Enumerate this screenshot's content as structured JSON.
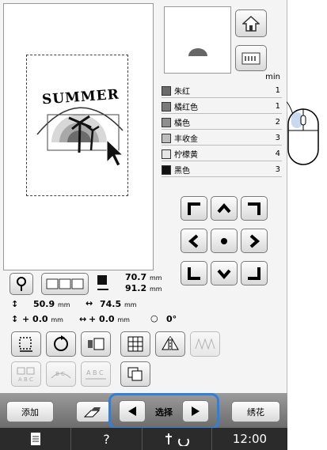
{
  "preview": {
    "design_text": "SUMMER"
  },
  "threads": {
    "header": "min",
    "items": [
      {
        "name": "朱红",
        "count": "1",
        "color": "#6b6b6b"
      },
      {
        "name": "橘红色",
        "count": "1",
        "color": "#7a7a7a"
      },
      {
        "name": "橘色",
        "count": "2",
        "color": "#8e8e8e"
      },
      {
        "name": "丰收金",
        "count": "3",
        "color": "#bdbdbd"
      },
      {
        "name": "柠檬黄",
        "count": "4",
        "color": "#e6e6e6"
      },
      {
        "name": "黑色",
        "count": "3",
        "color": "#111111"
      }
    ]
  },
  "size": {
    "width": "70.7",
    "height": "91.2",
    "unit": "mm"
  },
  "position": {
    "row1_a": "50.9",
    "row1_b": "74.5",
    "unit": "mm",
    "row2_a": "+  0.0",
    "row2_b": "+  0.0",
    "angle": "0°"
  },
  "bottom": {
    "add_label": "添加",
    "select_label": "选择",
    "embroider_label": "绣花",
    "time": "12:00"
  },
  "icons": {
    "home": "home-icon",
    "machine": "machine-icon",
    "zoom": "magnifier-icon",
    "mouse": "mouse-icon"
  }
}
